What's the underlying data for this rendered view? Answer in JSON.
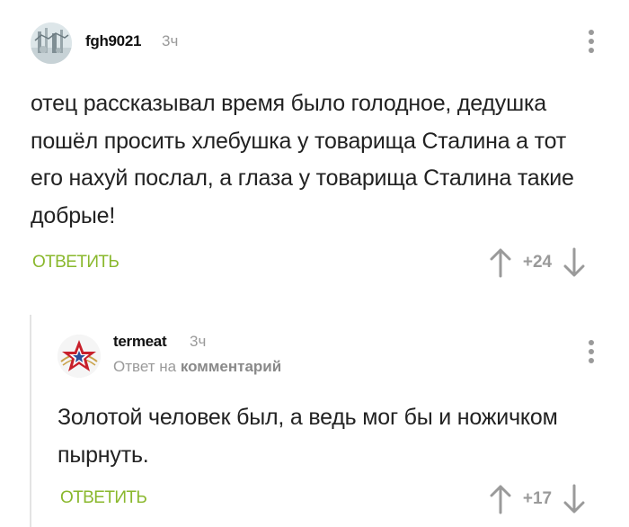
{
  "comments": [
    {
      "author": "fgh9021",
      "time": "3ч",
      "text": "отец рассказывал время было голодное, дедушка пошёл просить хлебушка у товарища Сталина а тот его нахуй послал, а глаза у товарища Сталина такие добрые!",
      "reply_label": "ОТВЕТИТЬ",
      "score": "+24"
    },
    {
      "author": "termeat",
      "time": "3ч",
      "reply_to_prefix": "Ответ на",
      "reply_to_link": "комментарий",
      "text": "Золотой человек был, а ведь мог бы и ножичком пырнуть.",
      "reply_label": "ОТВЕТИТЬ",
      "score": "+17"
    }
  ],
  "colors": {
    "accent_green": "#8ab82d",
    "muted": "#9a9a9a",
    "text": "#222222"
  },
  "icons": {
    "upvote": "arrow-up-icon",
    "downvote": "arrow-down-icon",
    "menu": "more-vertical-icon"
  }
}
